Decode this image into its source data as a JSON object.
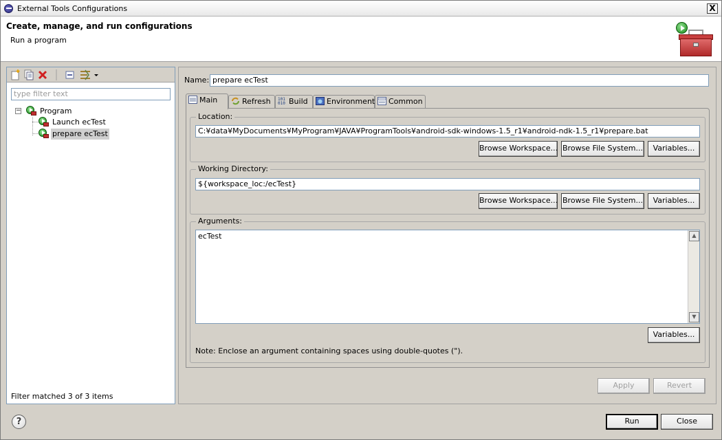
{
  "window": {
    "title": "External Tools Configurations",
    "close_glyph": "X"
  },
  "header": {
    "title": "Create, manage, and run configurations",
    "subtitle": "Run a program"
  },
  "left": {
    "filter_placeholder": "type filter text",
    "tree": {
      "root_label": "Program",
      "expander_glyph": "−",
      "children": [
        "Launch ecTest",
        "prepare ecTest"
      ]
    },
    "status": "Filter matched 3 of 3 items"
  },
  "name": {
    "label": "Name:",
    "value": "prepare ecTest"
  },
  "tabs": [
    "Main",
    "Refresh",
    "Build",
    "Environment",
    "Common"
  ],
  "active_tab": "Main",
  "location": {
    "label": "Location:",
    "value": "C:¥data¥MyDocuments¥MyProgram¥JAVA¥ProgramTools¥android-sdk-windows-1.5_r1¥android-ndk-1.5_r1¥prepare.bat",
    "buttons": [
      "Browse Workspace...",
      "Browse File System...",
      "Variables..."
    ]
  },
  "working_directory": {
    "label": "Working Directory:",
    "value": "${workspace_loc:/ecTest}",
    "buttons": [
      "Browse Workspace...",
      "Browse File System...",
      "Variables..."
    ]
  },
  "arguments": {
    "label": "Arguments:",
    "value": "ecTest",
    "variables_button": "Variables...",
    "note": "Note: Enclose an argument containing spaces using double-quotes (\")."
  },
  "actions": {
    "apply": "Apply",
    "revert": "Revert",
    "run": "Run",
    "close": "Close"
  },
  "help_glyph": "?",
  "colors": {
    "dialog_bg": "#d4d0c8",
    "selection": "#cfcfcf",
    "run_green": "#1a8a1a",
    "delete_red": "#d02020"
  },
  "icons": {
    "toolbar": [
      "new-config-icon",
      "duplicate-icon",
      "delete-icon",
      "collapse-all-icon",
      "filter-icon",
      "dropdown-icon"
    ],
    "tabs": [
      "main-tab-icon",
      "refresh-tab-icon",
      "build-tab-icon",
      "environment-tab-icon",
      "common-tab-icon"
    ]
  }
}
